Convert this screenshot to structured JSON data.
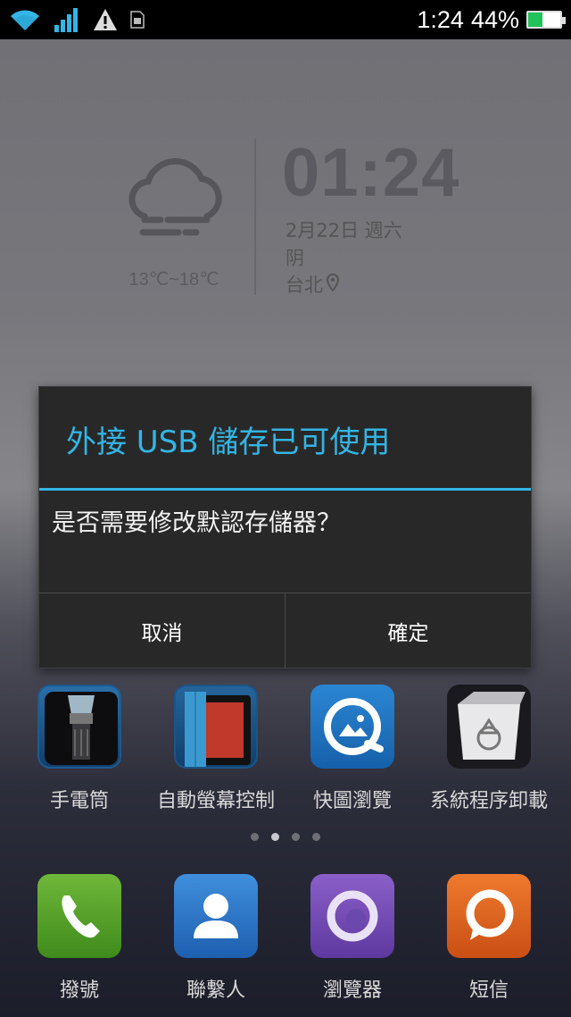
{
  "status_bar": {
    "time": "1:24",
    "battery_percent": "44%",
    "battery_level": 0.44,
    "icons": [
      "wifi-icon",
      "signal-icon",
      "warning-icon",
      "sim-icon"
    ]
  },
  "weather_widget": {
    "temp_range": "13℃~18℃",
    "clock": "01:24",
    "date": "2月22日 週六",
    "condition": "阴",
    "city": "台北"
  },
  "dialog": {
    "title": "外接 USB 儲存已可使用",
    "message": "是否需要修改默認存儲器？",
    "cancel_label": "取消",
    "ok_label": "確定",
    "accent_color": "#33b5e5"
  },
  "apps": [
    {
      "label": "手電筒",
      "icon": "flashlight-icon"
    },
    {
      "label": "自動螢幕控制",
      "icon": "tablet-cover-icon"
    },
    {
      "label": "快圖瀏覽",
      "icon": "gallery-icon"
    },
    {
      "label": "系統程序卸載",
      "icon": "recycle-bin-icon"
    }
  ],
  "page_indicator": {
    "count": 4,
    "active": 2
  },
  "dock": [
    {
      "label": "撥號",
      "icon": "phone-icon"
    },
    {
      "label": "聯繫人",
      "icon": "contacts-icon"
    },
    {
      "label": "瀏覽器",
      "icon": "browser-icon"
    },
    {
      "label": "短信",
      "icon": "message-icon"
    }
  ]
}
